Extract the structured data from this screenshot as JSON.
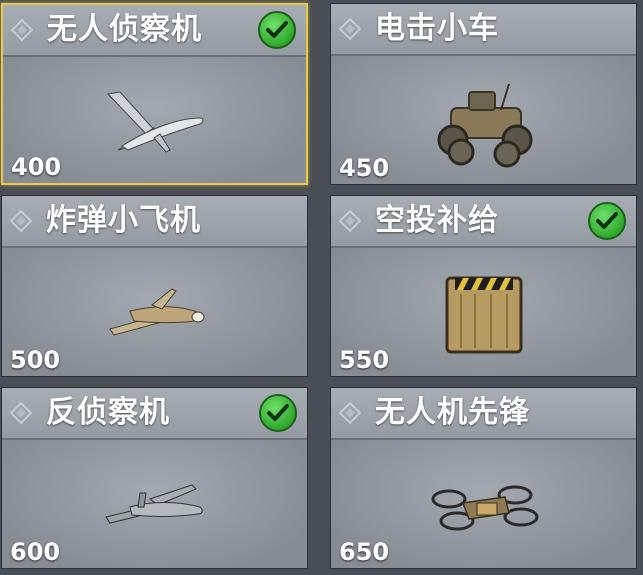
{
  "cards": [
    {
      "title": "无人侦察机",
      "price": "400",
      "selected": true,
      "checked": true,
      "icon": "recon-drone-icon"
    },
    {
      "title": "电击小车",
      "price": "450",
      "selected": false,
      "checked": false,
      "icon": "shock-rc-car-icon"
    },
    {
      "title": "炸弹小飞机",
      "price": "500",
      "selected": false,
      "checked": false,
      "icon": "bomb-plane-icon"
    },
    {
      "title": "空投补给",
      "price": "550",
      "selected": false,
      "checked": true,
      "icon": "care-package-icon"
    },
    {
      "title": "反侦察机",
      "price": "600",
      "selected": false,
      "checked": true,
      "icon": "counter-uav-icon"
    },
    {
      "title": "无人机先锋",
      "price": "650",
      "selected": false,
      "checked": false,
      "icon": "drone-quad-icon"
    }
  ],
  "colors": {
    "selected_border": "#e9c94a",
    "check_green": "#3fbf3a",
    "card_bg": "#8f959c"
  }
}
